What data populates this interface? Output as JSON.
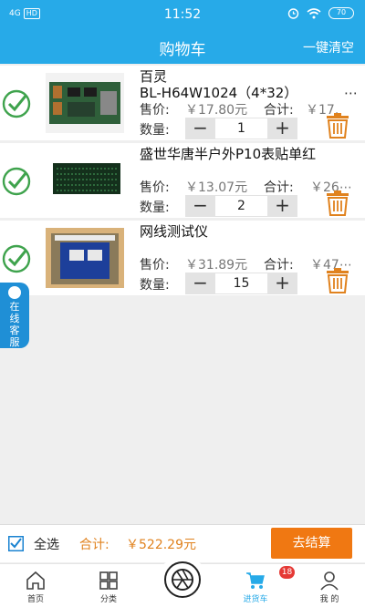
{
  "status": {
    "signal": "4G",
    "hd": "HD",
    "time": "11:52",
    "battery": "70"
  },
  "header": {
    "title": "购物车",
    "clear_label": "一键清空"
  },
  "items": [
    {
      "name": "百灵\nBL-H64W1024（4*32）",
      "more": "⋯",
      "price_label": "售价:",
      "price": "￥17.80元",
      "subtotal_label": "合计:",
      "subtotal": "￥17.",
      "qty_label": "数量:",
      "qty": "1"
    },
    {
      "name": "盛世华唐半户外P10表贴单红",
      "more": "",
      "price_label": "售价:",
      "price": "￥13.07元",
      "subtotal_label": "合计:",
      "subtotal": "￥26⋯",
      "qty_label": "数量:",
      "qty": "2"
    },
    {
      "name": "网线测试仪",
      "more": "",
      "price_label": "售价:",
      "price": "￥31.89元",
      "subtotal_label": "合计:",
      "subtotal": "￥47⋯",
      "qty_label": "数量:",
      "qty": "15"
    }
  ],
  "stepper": {
    "minus": "−",
    "plus": "+"
  },
  "service": {
    "label": "在线客服"
  },
  "footer": {
    "select_all": "全选",
    "total_label": "合计:",
    "total": "￥522.29元",
    "checkout": "去结算"
  },
  "tabs": [
    {
      "label": "首页",
      "icon": "home-icon"
    },
    {
      "label": "分类",
      "icon": "category-icon"
    },
    {
      "label": "",
      "icon": "camera-icon"
    },
    {
      "label": "进货车",
      "icon": "cart-icon",
      "badge": "18"
    },
    {
      "label": "我 的",
      "icon": "user-icon"
    }
  ],
  "colors": {
    "primary": "#27aae8",
    "check": "#3fa34d",
    "accent": "#f07812",
    "trash": "#e0821e"
  }
}
